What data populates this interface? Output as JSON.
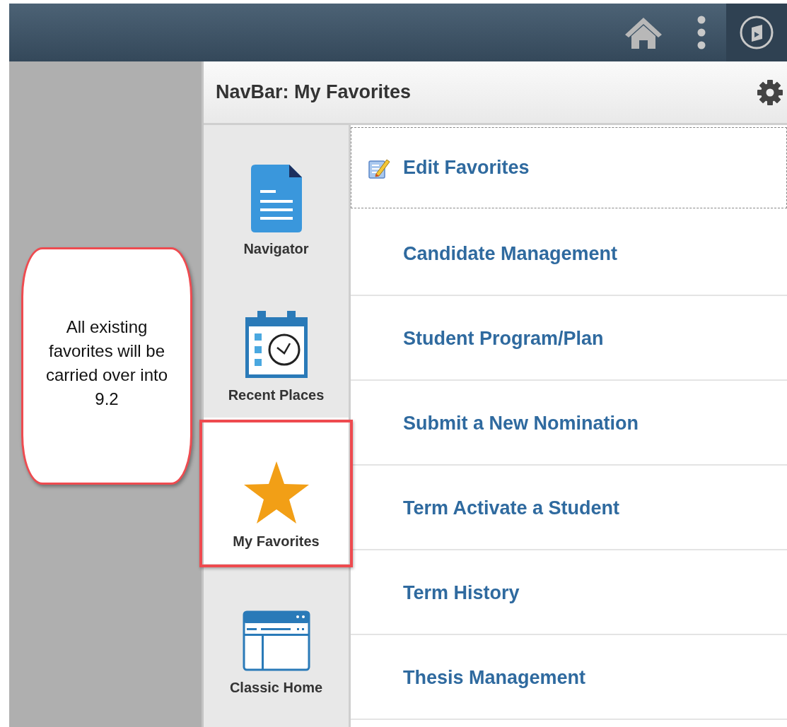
{
  "header": {
    "buttons": [
      {
        "kind": "home",
        "selected": false
      },
      {
        "kind": "more",
        "selected": false
      },
      {
        "kind": "navbar",
        "selected": true
      }
    ]
  },
  "panel": {
    "title": "NavBar: My Favorites"
  },
  "tiles": [
    {
      "kind": "navigator",
      "label": "Navigator",
      "selected": false,
      "highlighted": false
    },
    {
      "kind": "recent",
      "label": "Recent Places",
      "selected": false,
      "highlighted": false
    },
    {
      "kind": "favorites",
      "label": "My Favorites",
      "selected": true,
      "highlighted": true
    },
    {
      "kind": "classic",
      "label": "Classic Home",
      "selected": false,
      "highlighted": false
    }
  ],
  "favorites": [
    {
      "kind": "edit",
      "label": "Edit Favorites",
      "focused": true
    },
    {
      "kind": "link",
      "label": "Candidate Management",
      "focused": false
    },
    {
      "kind": "link",
      "label": "Student Program/Plan",
      "focused": false
    },
    {
      "kind": "link",
      "label": "Submit a New Nomination",
      "focused": false
    },
    {
      "kind": "link",
      "label": "Term Activate a Student",
      "focused": false
    },
    {
      "kind": "link",
      "label": "Term History",
      "focused": false
    },
    {
      "kind": "link",
      "label": "Thesis Management",
      "focused": false
    }
  ],
  "callout": {
    "text": "All existing favorites will be carried over into 9.2"
  }
}
